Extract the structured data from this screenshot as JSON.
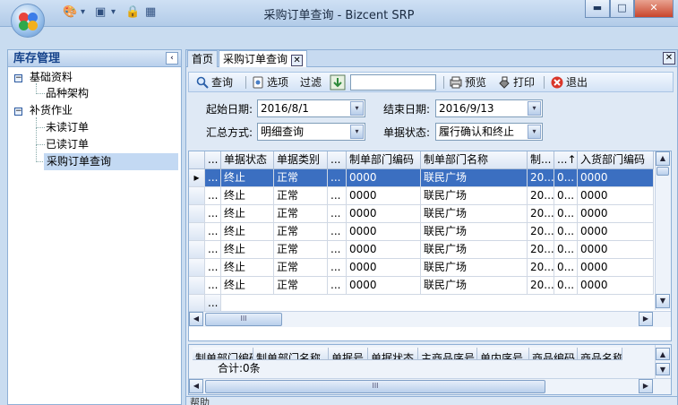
{
  "window": {
    "title": "采购订单查询 - Bizcent SRP",
    "controls": {
      "minimize": "▬",
      "maximize": "□",
      "close": "✕"
    }
  },
  "quick_access": {
    "palette_icon": "🎨",
    "layout_icon": "▣",
    "lock_icon": "🔒",
    "calc_icon": "▦",
    "dropdown": "▾"
  },
  "sidebar": {
    "title": "库存管理",
    "collapse": "‹",
    "tree": [
      {
        "label": "基础资料",
        "expander": "−",
        "children": [
          {
            "label": "品种架构"
          }
        ]
      },
      {
        "label": "补货作业",
        "expander": "−",
        "children": [
          {
            "label": "未读订单"
          },
          {
            "label": "已读订单"
          },
          {
            "label": "采购订单查询",
            "selected": true
          }
        ]
      }
    ]
  },
  "tabs": [
    {
      "label": "首页"
    },
    {
      "label": "采购订单查询",
      "close": "✕"
    }
  ],
  "panel_close": "✕",
  "toolbar": {
    "query": "查询",
    "options": "选项",
    "filter": "过滤",
    "preview": "预览",
    "print": "打印",
    "exit": "退出"
  },
  "filters": {
    "start_date_label": "起始日期:",
    "start_date": "2016/8/1",
    "end_date_label": "结束日期:",
    "end_date": "2016/9/13",
    "summary_label": "汇总方式:",
    "summary": "明细查询",
    "status_label": "单据状态:",
    "status": "履行确认和终止",
    "arrow": "▾"
  },
  "grid": {
    "columns": [
      "...",
      "单据状态",
      "单据类别",
      "...",
      "制单部门编码",
      "制单部门名称",
      "制...",
      "...↑",
      "入货部门编码"
    ],
    "rows": [
      [
        "...",
        "终止",
        "正常",
        "...",
        "0000",
        "联民广场",
        "20...",
        "0...",
        "0000"
      ],
      [
        "...",
        "终止",
        "正常",
        "...",
        "0000",
        "联民广场",
        "20...",
        "0...",
        "0000"
      ],
      [
        "...",
        "终止",
        "正常",
        "...",
        "0000",
        "联民广场",
        "20...",
        "0...",
        "0000"
      ],
      [
        "...",
        "终止",
        "正常",
        "...",
        "0000",
        "联民广场",
        "20...",
        "0...",
        "0000"
      ],
      [
        "...",
        "终止",
        "正常",
        "...",
        "0000",
        "联民广场",
        "20...",
        "0...",
        "0000"
      ],
      [
        "...",
        "终止",
        "正常",
        "...",
        "0000",
        "联民广场",
        "20...",
        "0...",
        "0000"
      ],
      [
        "...",
        "终止",
        "正常",
        "...",
        "0000",
        "联民广场",
        "20...",
        "0...",
        "0000"
      ]
    ],
    "current_row_marker": "▸",
    "footer_cell": "...",
    "scroll_thumb_grip": "III"
  },
  "detail_grid": {
    "columns": [
      "制单部门编码",
      "制单部门名称",
      "单据号",
      "单据状态",
      "主商品序号",
      "单内序号",
      "商品编码",
      "商品名称"
    ],
    "total": "合计:0条",
    "scroll_thumb_grip": "III"
  },
  "help": {
    "label": "帮助"
  }
}
